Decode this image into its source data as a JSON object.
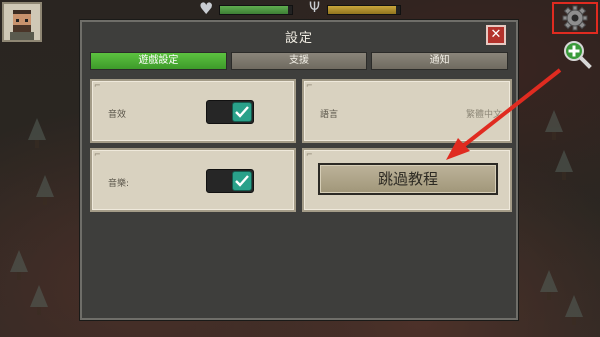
{
  "dialog": {
    "title": "設定",
    "close_icon": "close-icon"
  },
  "tabs": [
    {
      "label": "遊戲設定",
      "active": true
    },
    {
      "label": "支援",
      "active": false
    },
    {
      "label": "通知",
      "active": false
    }
  ],
  "settings": {
    "sound_label": "音效",
    "sound_enabled": true,
    "music_label": "音樂:",
    "music_enabled": true,
    "language_label": "語言",
    "language_value": "繁體中文",
    "skip_tutorial_label": "跳過教程"
  },
  "hud": {
    "heart_icon": "heart-icon",
    "health_fill": 0.95,
    "hunger_icon": "fork-knife-icon",
    "hunger_fill": 0.95,
    "settings_icon": "gear-icon",
    "zoom_icon": "zoom-in-icon"
  },
  "colors": {
    "tab_active": "#4caf35",
    "annotation_red": "#e02b20",
    "toggle_on": "#2aa18a"
  }
}
